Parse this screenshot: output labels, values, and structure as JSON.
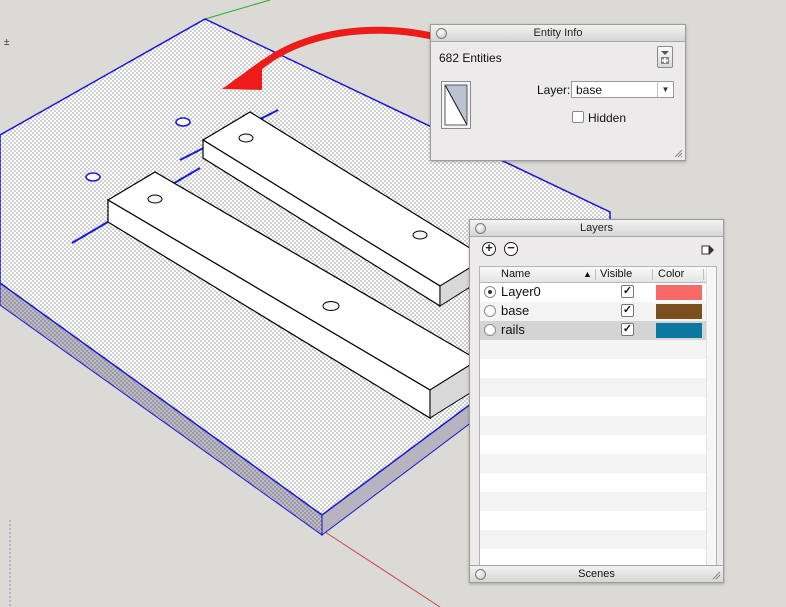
{
  "entity_info": {
    "title": "Entity Info",
    "entity_count": "682 Entities",
    "layer_label": "Layer:",
    "layer_value": "base",
    "hidden_label": "Hidden",
    "hidden_checked": false
  },
  "layers": {
    "title": "Layers",
    "columns": {
      "name": "Name",
      "visible": "Visible",
      "color": "Color"
    },
    "rows": [
      {
        "name": "Layer0",
        "active": true,
        "visible": true,
        "color": "#f86a68"
      },
      {
        "name": "base",
        "active": false,
        "visible": true,
        "color": "#7b4f1e"
      },
      {
        "name": "rails",
        "active": false,
        "visible": true,
        "color": "#0c78a0"
      }
    ],
    "footer": "Scenes"
  },
  "viewport": {
    "axis_tick": "±"
  },
  "colors": {
    "arrow": "#ee1b1b",
    "edge_highlight": "#1a1ad0",
    "green_axis": "#22b022",
    "red_axis": "#d44444"
  }
}
